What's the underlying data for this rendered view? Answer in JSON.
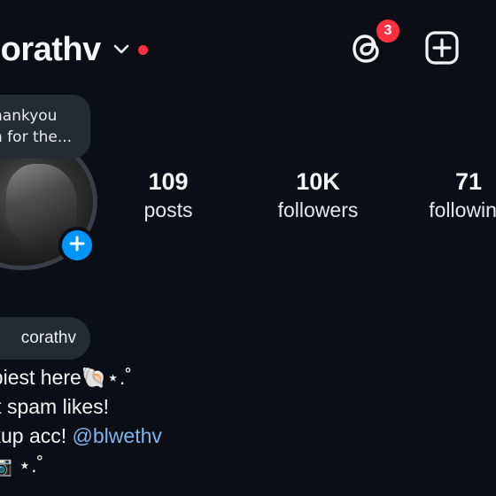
{
  "header": {
    "username": "corathv",
    "notification_count": "3"
  },
  "icons": {
    "dropdown": "chevron-down-icon",
    "threads": "threads-icon",
    "add": "plus-square-icon",
    "story_add": "plus-circle-icon"
  },
  "colors": {
    "background": "#0b0e14",
    "badge_red": "#ff3040",
    "accent_blue": "#0095f6",
    "mention_blue": "#7fb4ee",
    "bubble": "#262a31"
  },
  "note": {
    "line1": "hankyou",
    "line2": "n for the..."
  },
  "stats": {
    "posts": {
      "value": "109",
      "label": "posts"
    },
    "followers": {
      "value": "10K",
      "label": "followers"
    },
    "following": {
      "value": "71",
      "label": "following"
    }
  },
  "threads_pill": {
    "label": "corathv"
  },
  "bio": {
    "line1": "ppiest here🐚⋆.˚",
    "line2": "n't spam likes!",
    "line3_prefix": "ckup acc! ",
    "line3_mention": "@blwethv",
    "line4": "˚📷 ⋆.˚"
  }
}
